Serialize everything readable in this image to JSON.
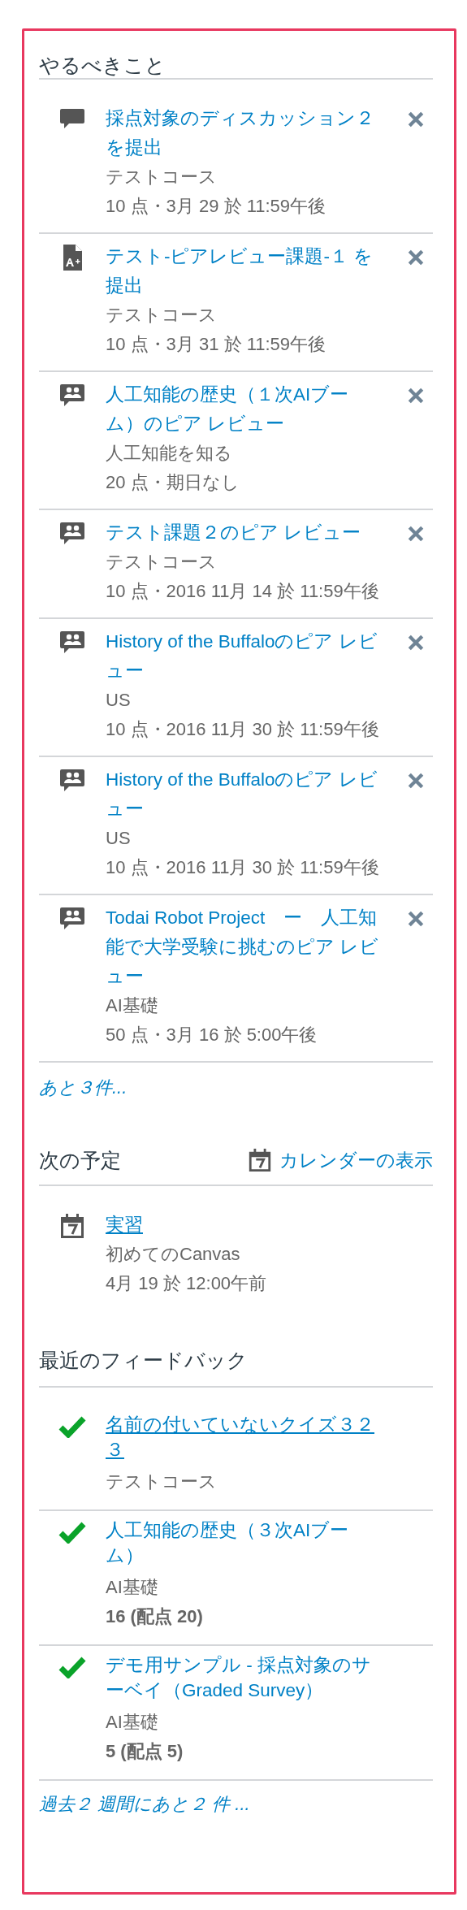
{
  "todo": {
    "title": "やるべきこと",
    "items": [
      {
        "kind": "discussion",
        "title": "採点対象のディスカッション２を提出",
        "course": "テストコース",
        "meta": "10 点・3月 29 於 11:59午後"
      },
      {
        "kind": "assignment",
        "title": "テスト-ピアレビュー課題-１ を提出",
        "course": "テストコース",
        "meta": "10 点・3月 31 於 11:59午後"
      },
      {
        "kind": "peer_review",
        "title": "人工知能の歴史（１次AIブーム）のピア レビュー",
        "course": "人工知能を知る",
        "meta": "20 点・期日なし"
      },
      {
        "kind": "peer_review",
        "title": "テスト課題２のピア レビュー",
        "course": "テストコース",
        "meta": "10 点・2016 11月 14 於 11:59午後"
      },
      {
        "kind": "peer_review",
        "title": "History of the Buffaloのピア レビュー",
        "course": "US",
        "meta": "10 点・2016 11月 30 於 11:59午後"
      },
      {
        "kind": "peer_review",
        "title": "History of the Buffaloのピア レビュー",
        "course": "US",
        "meta": "10 点・2016 11月 30 於 11:59午後"
      },
      {
        "kind": "peer_review",
        "title": "Todai Robot Project　ー　人工知能で大学受験に挑むのピア レビュー",
        "course": "AI基礎",
        "meta": "50 点・3月 16 於 5:00午後"
      }
    ],
    "more_link": "あと３件..."
  },
  "upcoming": {
    "title": "次の予定",
    "calendar_link": "カレンダーの表示",
    "items": [
      {
        "kind": "event",
        "title": "実習",
        "underlined": true,
        "course": "初めてのCanvas",
        "meta": "4月 19 於 12:00午前"
      }
    ]
  },
  "feedback": {
    "title": "最近のフィードバック",
    "items": [
      {
        "title": "名前の付いていないクイズ３２３",
        "underlined": true,
        "course": "テストコース"
      },
      {
        "title": "人工知能の歴史（３次AIブーム）",
        "underlined": false,
        "course": "AI基礎",
        "score": "16 (配点 20)"
      },
      {
        "title": "デモ用サンプル - 採点対象のサーベイ（Graded Survey）",
        "underlined": false,
        "course": "AI基礎",
        "score": "5 (配点 5)"
      }
    ],
    "more_link": "過去２ 週間にあと２ 件 ..."
  }
}
